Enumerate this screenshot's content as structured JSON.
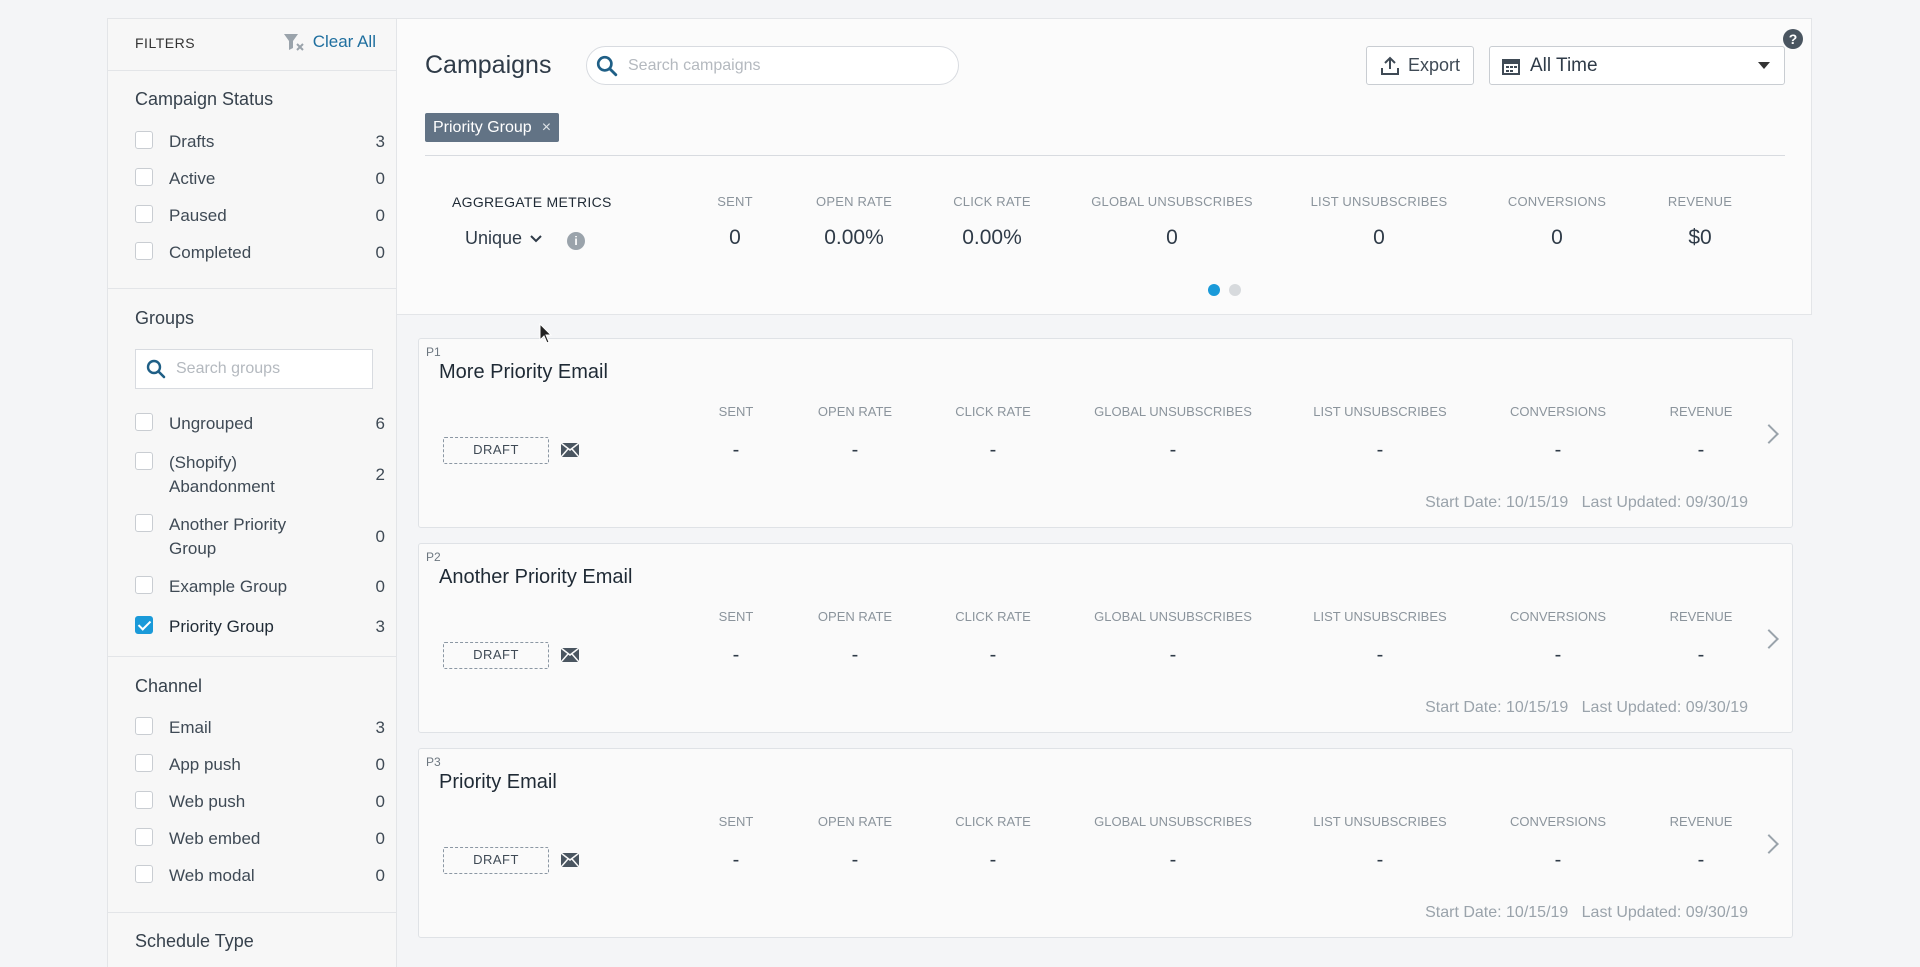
{
  "sidebar": {
    "title": "FILTERS",
    "clear_all": "Clear All",
    "status": {
      "title": "Campaign Status",
      "items": [
        {
          "label": "Drafts",
          "count": "3"
        },
        {
          "label": "Active",
          "count": "0"
        },
        {
          "label": "Paused",
          "count": "0"
        },
        {
          "label": "Completed",
          "count": "0"
        }
      ]
    },
    "groups": {
      "title": "Groups",
      "search_placeholder": "Search groups",
      "items": [
        {
          "label": "Ungrouped",
          "count": "6",
          "checked": false
        },
        {
          "label": "(Shopify) Abandonment",
          "count": "2",
          "checked": false
        },
        {
          "label": "Another Priority Group",
          "count": "0",
          "checked": false
        },
        {
          "label": "Example Group",
          "count": "0",
          "checked": false
        },
        {
          "label": "Priority Group",
          "count": "3",
          "checked": true
        }
      ]
    },
    "channel": {
      "title": "Channel",
      "items": [
        {
          "label": "Email",
          "count": "3"
        },
        {
          "label": "App push",
          "count": "0"
        },
        {
          "label": "Web push",
          "count": "0"
        },
        {
          "label": "Web embed",
          "count": "0"
        },
        {
          "label": "Web modal",
          "count": "0"
        }
      ]
    },
    "schedule_title": "Schedule Type"
  },
  "header": {
    "title": "Campaigns",
    "search_placeholder": "Search campaigns",
    "export": "Export",
    "date_range": "All Time",
    "help": "?",
    "active_tag": "Priority Group",
    "tag_remove": "×"
  },
  "aggregate": {
    "label": "AGGREGATE METRICS",
    "mode": "Unique",
    "metrics": [
      {
        "name": "SENT",
        "value": "0"
      },
      {
        "name": "OPEN RATE",
        "value": "0.00%"
      },
      {
        "name": "CLICK RATE",
        "value": "0.00%"
      },
      {
        "name": "GLOBAL UNSUBSCRIBES",
        "value": "0"
      },
      {
        "name": "LIST UNSUBSCRIBES",
        "value": "0"
      },
      {
        "name": "CONVERSIONS",
        "value": "0"
      },
      {
        "name": "REVENUE",
        "value": "$0"
      }
    ],
    "pager": {
      "pages": 2,
      "active": 1
    },
    "colors": {
      "active_dot": "#1a9ad9",
      "inactive_dot": "#d7dadd"
    }
  },
  "campaigns": [
    {
      "priority": "P1",
      "name": "More Priority Email",
      "status": "DRAFT",
      "metric_names": [
        "SENT",
        "OPEN RATE",
        "CLICK RATE",
        "GLOBAL UNSUBSCRIBES",
        "LIST UNSUBSCRIBES",
        "CONVERSIONS",
        "REVENUE"
      ],
      "metric_values": [
        "-",
        "-",
        "-",
        "-",
        "-",
        "-",
        "-"
      ],
      "dates": "Start Date: 10/15/19   Last Updated: 09/30/19"
    },
    {
      "priority": "P2",
      "name": "Another Priority Email",
      "status": "DRAFT",
      "metric_names": [
        "SENT",
        "OPEN RATE",
        "CLICK RATE",
        "GLOBAL UNSUBSCRIBES",
        "LIST UNSUBSCRIBES",
        "CONVERSIONS",
        "REVENUE"
      ],
      "metric_values": [
        "-",
        "-",
        "-",
        "-",
        "-",
        "-",
        "-"
      ],
      "dates": "Start Date: 10/15/19   Last Updated: 09/30/19"
    },
    {
      "priority": "P3",
      "name": "Priority Email",
      "status": "DRAFT",
      "metric_names": [
        "SENT",
        "OPEN RATE",
        "CLICK RATE",
        "GLOBAL UNSUBSCRIBES",
        "LIST UNSUBSCRIBES",
        "CONVERSIONS",
        "REVENUE"
      ],
      "metric_values": [
        "-",
        "-",
        "-",
        "-",
        "-",
        "-",
        "-"
      ],
      "dates": "Start Date: 10/15/19   Last Updated: 09/30/19"
    }
  ]
}
